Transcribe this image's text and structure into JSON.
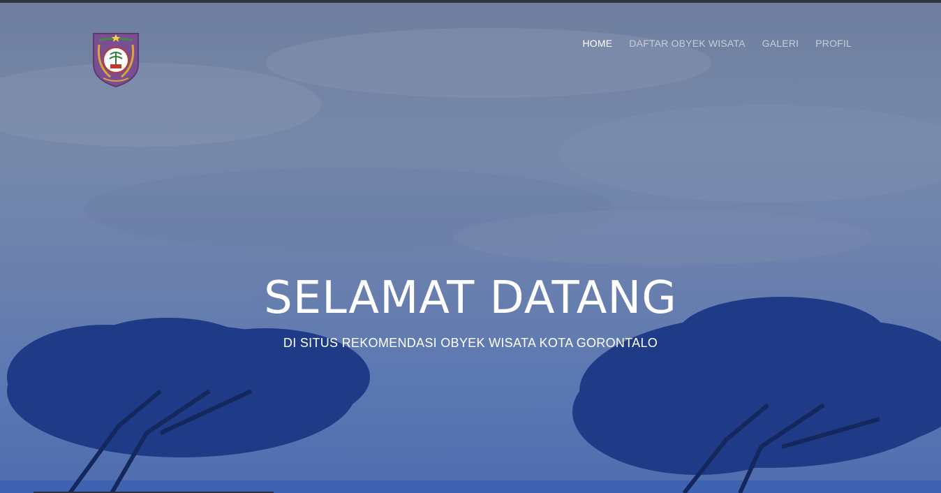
{
  "nav": {
    "items": [
      {
        "label": "HOME",
        "active": true
      },
      {
        "label": "DAFTAR OBYEK WISATA",
        "active": false
      },
      {
        "label": "GALERI",
        "active": false
      },
      {
        "label": "PROFIL",
        "active": false
      }
    ]
  },
  "hero": {
    "title": "SELAMAT DATANG",
    "subtitle": "DI SITUS REKOMENDASI OBYEK WISATA KOTA GORONTALO"
  },
  "logo": {
    "icon": "gorontalo-emblem-icon"
  },
  "colors": {
    "nav_text": "#c9cdd8",
    "nav_active": "#ffffff",
    "hero_tint": "#5d79b2",
    "emblem_shield": "#7b4e92"
  }
}
